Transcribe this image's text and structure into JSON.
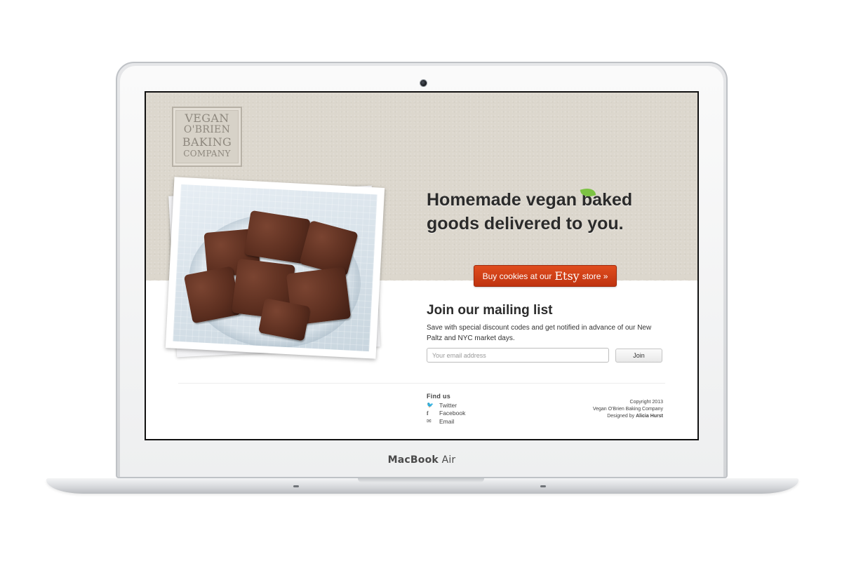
{
  "device": {
    "brand": "MacBook",
    "model": "Air"
  },
  "logo": {
    "lines": [
      "VEGAN",
      "O'BRIEN",
      "BAKING",
      "COMPANY"
    ]
  },
  "hero": {
    "headline": "Homemade vegan baked goods delivered to you.",
    "cta": {
      "prefix": "Buy cookies at our",
      "etsy": "Etsy",
      "suffix": "store »"
    }
  },
  "mailing": {
    "title": "Join our mailing list",
    "description": "Save with special discount codes and get notified in advance of our New Paltz and NYC market days.",
    "email_placeholder": "Your email address",
    "join_label": "Join"
  },
  "footer": {
    "find_title": "Find us",
    "links": [
      {
        "icon": "twitter-icon",
        "label": "Twitter"
      },
      {
        "icon": "facebook-icon",
        "label": "Facebook"
      },
      {
        "icon": "email-icon",
        "label": "Email"
      }
    ],
    "copyright": "Copyright 2013",
    "company": "Vegan O'Brien Baking Company",
    "designed_prefix": "Designed by",
    "designer": "Alicia Hurst"
  },
  "colors": {
    "cta": "#d0421a",
    "leaf": "#7cc243",
    "hero_bg": "#dcd7cd"
  }
}
